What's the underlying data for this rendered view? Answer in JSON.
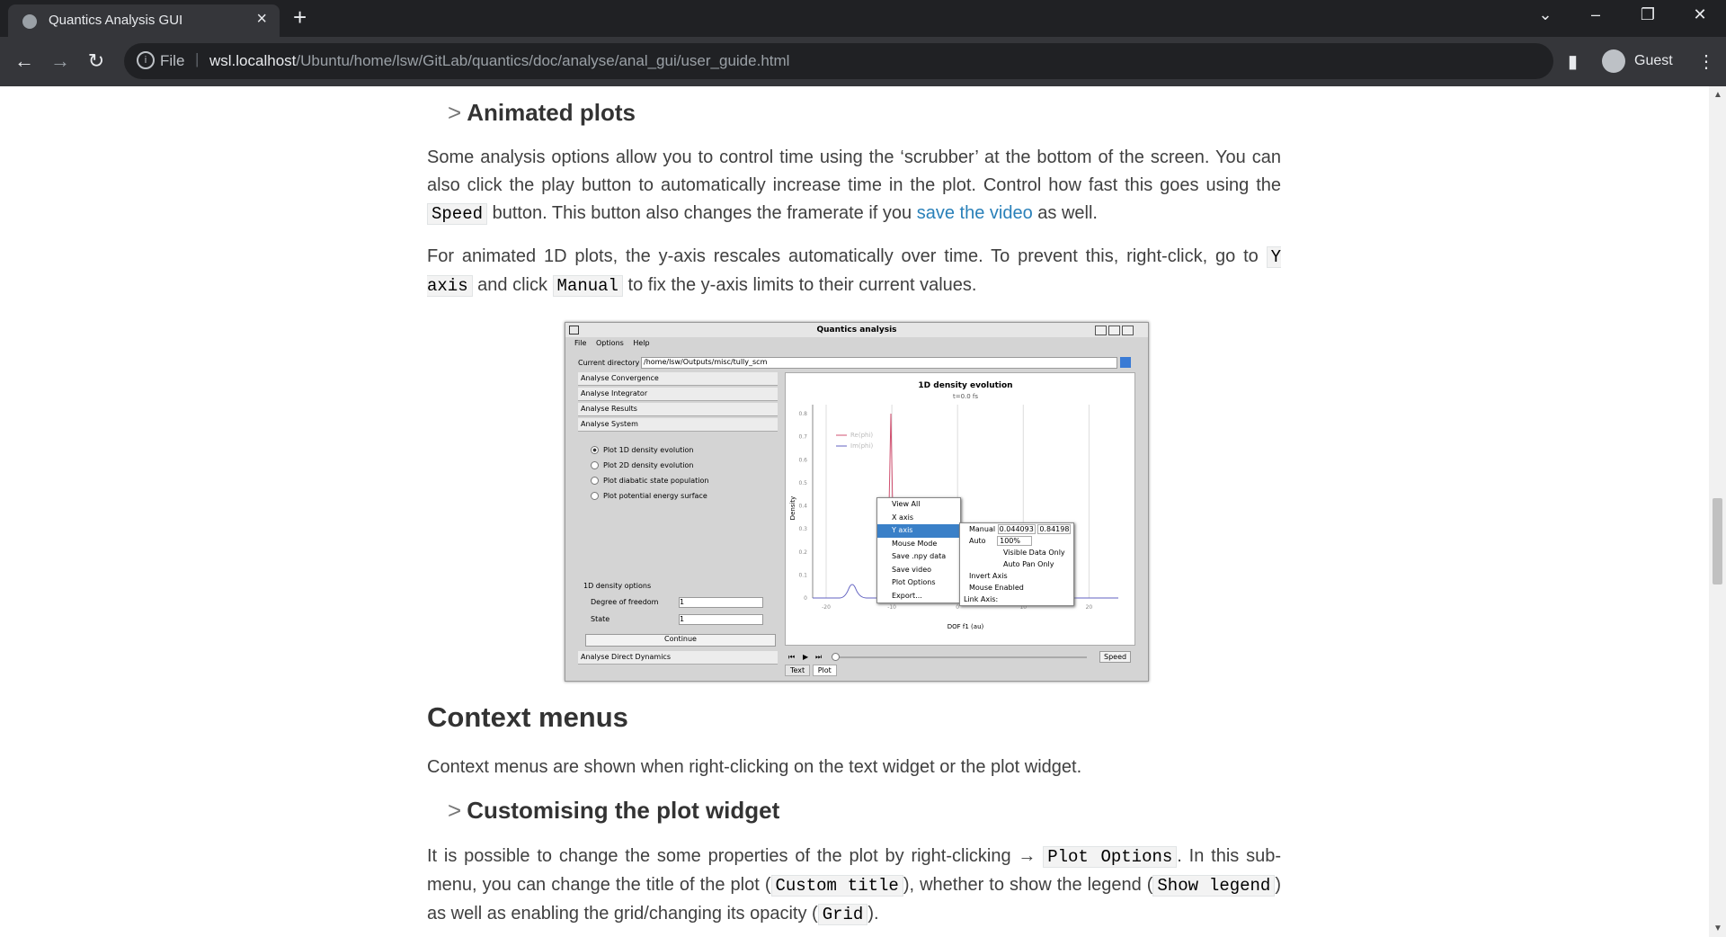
{
  "browser": {
    "tab_title": "Quantics Analysis GUI",
    "url_scheme": "File",
    "url_host": "wsl.localhost",
    "url_path": "/Ubuntu/home/lsw/GitLab/quantics/doc/analyse/anal_gui/user_guide.html",
    "profile_name": "Guest"
  },
  "content": {
    "h_animated": "Animated plots",
    "p1_a": "Some analysis options allow you to control time using the ‘scrubber’ at the bottom of the screen. You can also click the play button to automatically increase time in the plot. Control how fast this goes using the ",
    "p1_code": "Speed",
    "p1_b": " button. This button also changes the framerate if you ",
    "p1_link": "save the video",
    "p1_c": " as well.",
    "p2_a": "For animated 1D plots, the y-axis rescales automatically over time. To prevent this, right-click, go to ",
    "p2_code1": "Y axis",
    "p2_b": " and click ",
    "p2_code2": "Manual",
    "p2_c": " to fix the y-axis limits to their current values.",
    "h_context": "Context menus",
    "p3": "Context menus are shown when right-clicking on the text widget or the plot widget.",
    "h_customising": "Customising the plot widget",
    "p4_a": "It is possible to change the some properties of the plot by right-clicking → ",
    "p4_code1": "Plot Options",
    "p4_b": ". In this sub-menu, you can change the title of the plot (",
    "p4_code2": "Custom title",
    "p4_c": "), whether to show the legend (",
    "p4_code3": "Show legend",
    "p4_d": ") as well as enabling the grid/changing its opacity (",
    "p4_code4": "Grid",
    "p4_e": ")."
  },
  "screenshot": {
    "window_title": "Quantics analysis",
    "menus": [
      "File",
      "Options",
      "Help"
    ],
    "curdir_label": "Current directory",
    "curdir_value": "/home/lsw/Outputs/misc/tully_scm",
    "accordion": [
      "Analyse Convergence",
      "Analyse Integrator",
      "Analyse Results",
      "Analyse System"
    ],
    "radios": [
      "Plot 1D density evolution",
      "Plot 2D density evolution",
      "Plot diabatic state population",
      "Plot potential energy surface"
    ],
    "options_label": "1D density options",
    "dof_label": "Degree of freedom",
    "dof_value": "1",
    "state_label": "State",
    "state_value": "1",
    "continue_label": "Continue",
    "last_acc": "Analyse Direct Dynamics",
    "plot_title": "1D density evolution",
    "plot_subtitle": "t=0.0 fs",
    "ylabel": "Density",
    "xlabel": "DOF f1 (au)",
    "legend": [
      "Re(phi)",
      "Im(phi)"
    ],
    "yticks": [
      "0.8",
      "0.7",
      "0.6",
      "0.5",
      "0.4",
      "0.3",
      "0.2",
      "0.1",
      "0"
    ],
    "xticks": [
      "-20",
      "-10",
      "0",
      "10",
      "20"
    ],
    "ctx_menu": [
      "View All",
      "X axis",
      "Y axis",
      "Mouse Mode",
      "Save .npy data",
      "Save video",
      "Plot Options",
      "Export..."
    ],
    "sub_manual": "Manual",
    "sub_min": "0.044093",
    "sub_max": "0.84198",
    "sub_auto": "Auto",
    "sub_auto_val": "100%",
    "sub_visible": "Visible Data Only",
    "sub_autopan": "Auto Pan Only",
    "sub_invert": "Invert Axis",
    "sub_mouse": "Mouse Enabled",
    "sub_link": "Link Axis:",
    "speed_label": "Speed",
    "tabs": [
      "Text",
      "Plot"
    ]
  }
}
